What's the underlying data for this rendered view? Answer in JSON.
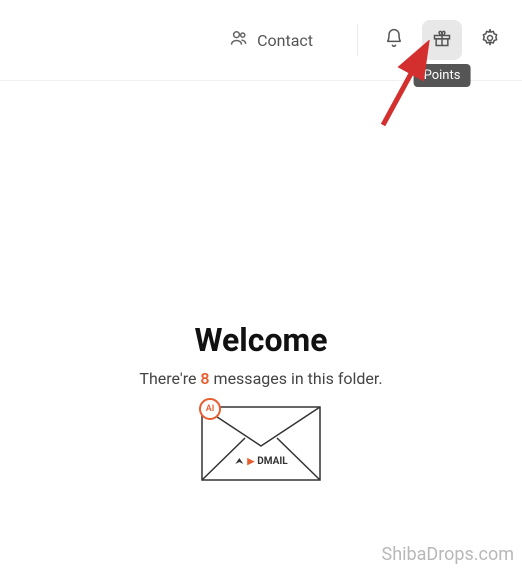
{
  "header": {
    "contact_label": "Contact",
    "tooltip_points": "Points"
  },
  "main": {
    "title": "Welcome",
    "msg_prefix": "There're ",
    "message_count": "8",
    "msg_suffix": " messages in this folder.",
    "ai_badge": "AI",
    "brand": "DMAIL"
  },
  "watermark": "ShibaDrops.com"
}
